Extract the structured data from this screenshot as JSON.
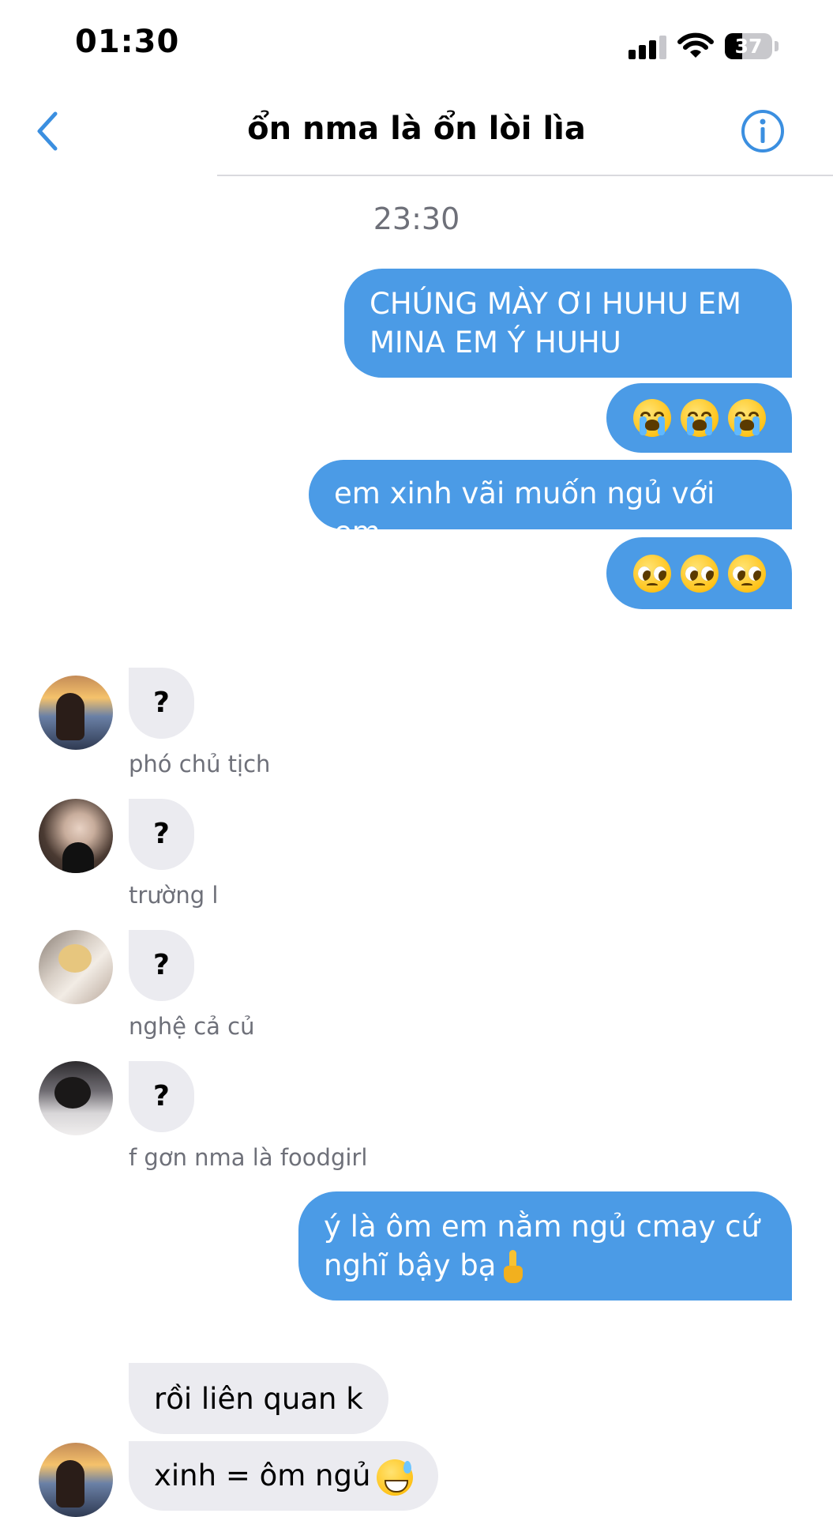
{
  "status_bar": {
    "time": "01:30",
    "battery": "37",
    "battery_level": 0.37,
    "signal_bars": 3
  },
  "nav": {
    "title": "ổn nma là ổn lòi lìa"
  },
  "timestamp": "23:30",
  "messages_out": {
    "m1": "CHÚNG MÀY ƠI HUHU EM MINA EM Ý HUHU",
    "m2_emojis": [
      "loudly-crying-face",
      "loudly-crying-face",
      "loudly-crying-face"
    ],
    "m3": "em xinh vãi muốn ngủ với em",
    "m4_emojis": [
      "pleading-face",
      "pleading-face",
      "pleading-face"
    ],
    "m5": "ý là ôm em nằm ngủ cmay cứ nghĩ bậy bạ",
    "m5_emoji": "backhand-index-pointing-up"
  },
  "replies": [
    {
      "text": "?",
      "sender": "phó chủ tịch"
    },
    {
      "text": "?",
      "sender": "trường l"
    },
    {
      "text": "?",
      "sender": "nghệ cả củ"
    },
    {
      "text": "?",
      "sender": "f gơn nma là foodgirl"
    }
  ],
  "last_messages": {
    "r1": "rồi liên quan k",
    "r2": "xinh = ôm ngủ",
    "r2_emoji": "grinning-face-with-sweat"
  },
  "colors": {
    "outgoing": "#4b9be6",
    "incoming": "#ebebf0",
    "accent": "#3b8fe0"
  }
}
